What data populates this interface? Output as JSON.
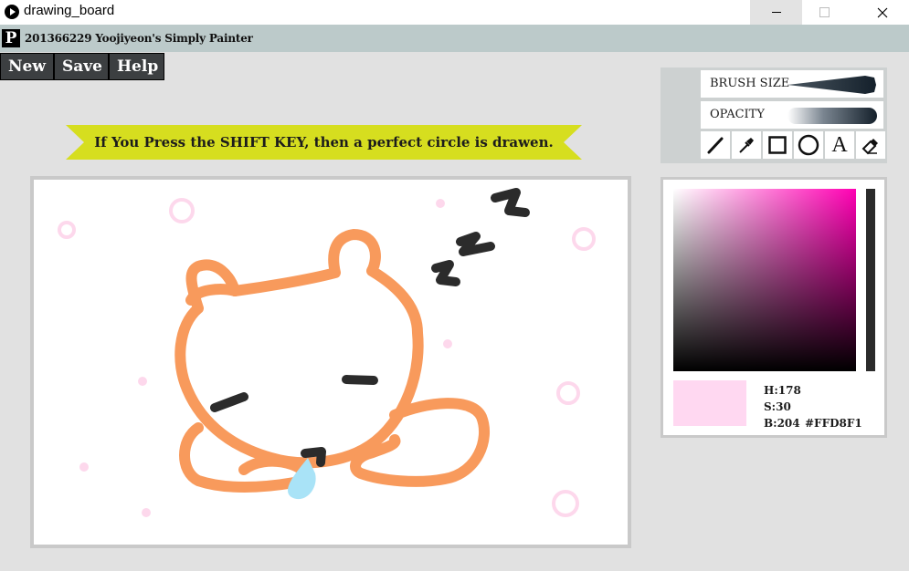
{
  "window": {
    "title": "drawing_board"
  },
  "header": {
    "logo_letter": "P",
    "app_title": "201366229 Yoojiyeon's Simply Painter"
  },
  "menu": {
    "new_label": "New",
    "save_label": "Save",
    "help_label": "Help"
  },
  "banner": {
    "text": "If You Press the SHIFT KEY, then a perfect circle is drawen."
  },
  "tools": {
    "brush_size_label": "BRUSH SIZE",
    "opacity_label": "OPACITY",
    "text_tool_glyph": "A",
    "items": [
      "pen-icon",
      "eyedropper-icon",
      "rectangle-icon",
      "circle-icon",
      "text-icon",
      "eraser-icon"
    ]
  },
  "color": {
    "h": "H:178",
    "s": "S:30",
    "b": "B:204",
    "hex": "#FFD8F1",
    "swatch_color": "#FFD8F1",
    "picker_hue_color": "#FF00B3"
  },
  "canvas": {
    "stroke_colors": {
      "bear": "#F89A5C",
      "dark": "#2B2B2B",
      "drop": "#A9E3F7",
      "dots": "#FDD8EC"
    }
  }
}
